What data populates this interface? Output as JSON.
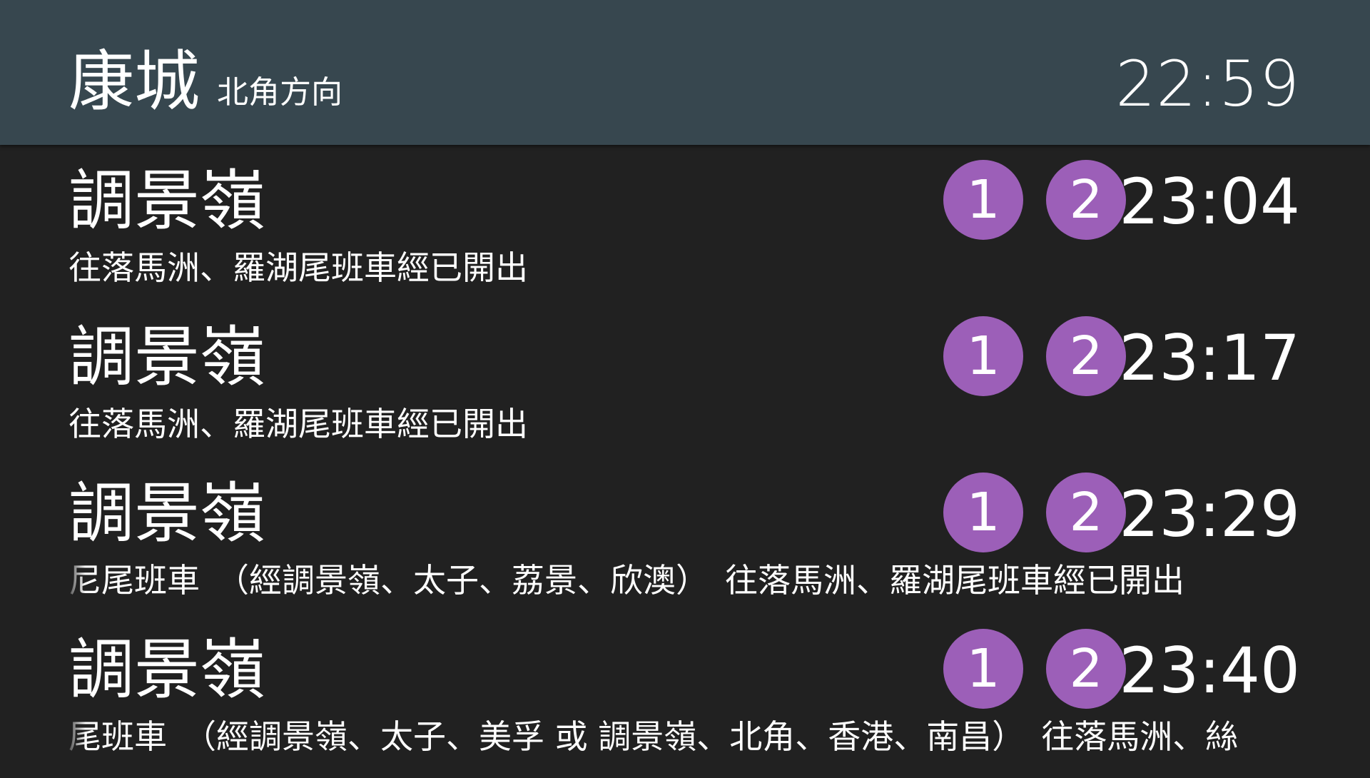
{
  "header": {
    "station": "康城",
    "direction": "北角方向",
    "clock": "22:59"
  },
  "colors": {
    "header_bg": "#37474f",
    "body_bg": "#212121",
    "platform_badge": "#9c5fb8",
    "text": "#ffffff"
  },
  "departures": [
    {
      "destination": "調景嶺",
      "platforms": [
        "1",
        "2"
      ],
      "time": "23:04",
      "message": "往落馬洲、羅湖尾班車經已開出"
    },
    {
      "destination": "調景嶺",
      "platforms": [
        "1",
        "2"
      ],
      "time": "23:17",
      "message": "往落馬洲、羅湖尾班車經已開出"
    },
    {
      "destination": "調景嶺",
      "platforms": [
        "1",
        "2"
      ],
      "time": "23:29",
      "message": "尼尾班車　（經調景嶺、太子、荔景、欣澳）　往落馬洲、羅湖尾班車經已開出"
    },
    {
      "destination": "調景嶺",
      "platforms": [
        "1",
        "2"
      ],
      "time": "23:40",
      "message": "尾班車　（經調景嶺、太子、美孚 或 調景嶺、北角、香港、南昌）　往落馬洲、絲"
    }
  ]
}
